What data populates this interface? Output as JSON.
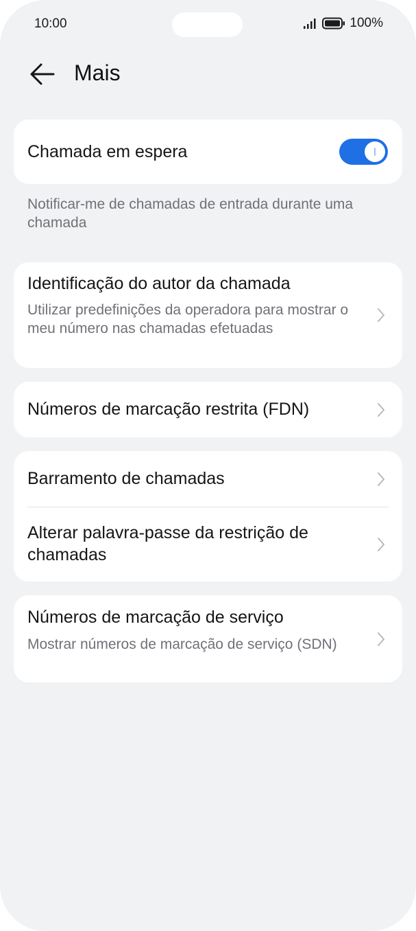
{
  "status_bar": {
    "time": "10:00",
    "battery": "100%"
  },
  "header": {
    "title": "Mais"
  },
  "call_waiting": {
    "label": "Chamada em espera",
    "enabled": true,
    "description": "Notificar-me de chamadas de entrada durante uma chamada"
  },
  "caller_id": {
    "title": "Identificação do autor da chamada",
    "subtitle": "Utilizar predefinições da operadora para mostrar o meu número nas chamadas efetuadas"
  },
  "fdn": {
    "title": "Números de marcação restrita (FDN)"
  },
  "barring": {
    "title": "Barramento de chamadas",
    "change_password": "Alterar palavra-passe da restrição de chamadas"
  },
  "sdn": {
    "title": "Números de marcação de serviço",
    "subtitle": "Mostrar números de marcação de serviço (SDN)"
  },
  "colors": {
    "accent": "#1f6fe5",
    "background": "#f1f2f4",
    "card": "#ffffff"
  }
}
